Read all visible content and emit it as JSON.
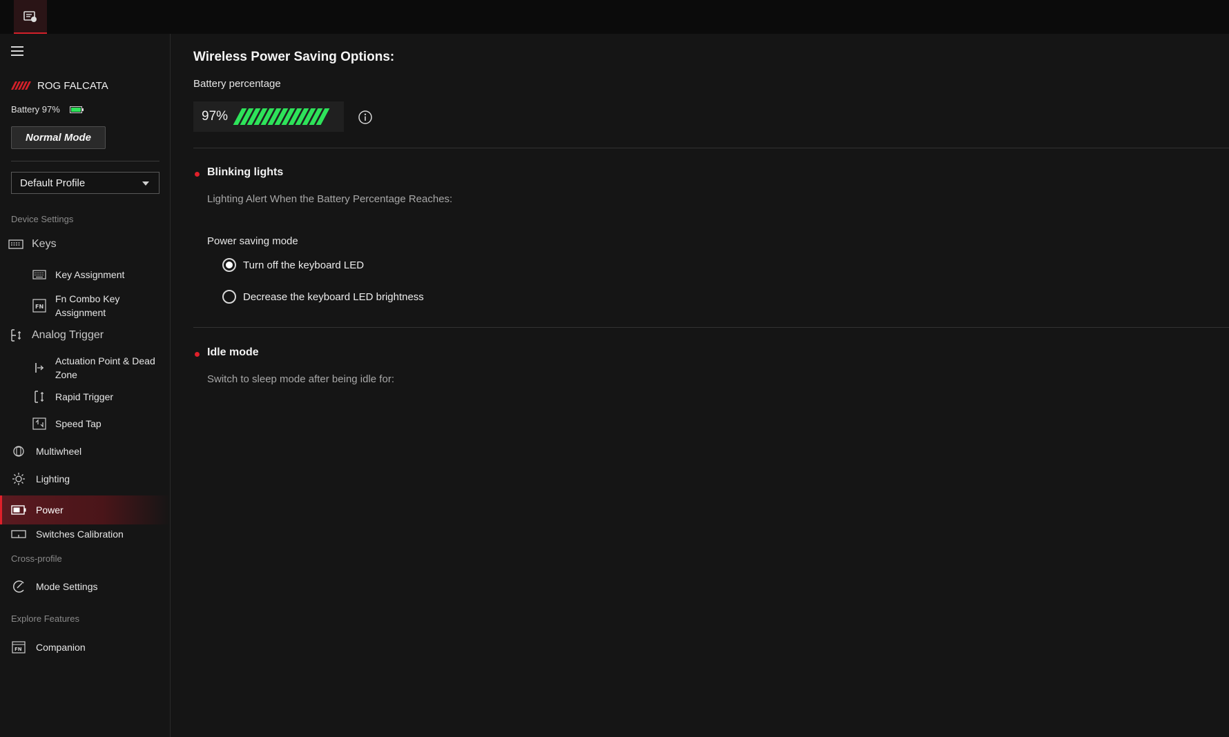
{
  "app": {
    "tab_icon": "armoury-app-icon"
  },
  "sidebar": {
    "device_name": "ROG FALCATA",
    "battery_label": "Battery 97%",
    "mode_button": "Normal Mode",
    "profile": "Default Profile",
    "section_device": "Device Settings",
    "section_cross": "Cross-profile",
    "section_explore": "Explore Features",
    "items": {
      "keys": "Keys",
      "key_assignment": "Key Assignment",
      "fn_combo": "Fn Combo Key Assignment",
      "analog_trigger": "Analog Trigger",
      "actuation": "Actuation Point & Dead Zone",
      "rapid_trigger": "Rapid Trigger",
      "speed_tap": "Speed Tap",
      "multiwheel": "Multiwheel",
      "lighting": "Lighting",
      "power": "Power",
      "switches_calibration": "Switches Calibration",
      "mode_settings": "Mode Settings",
      "companion": "Companion"
    }
  },
  "main": {
    "title": "Wireless Power Saving Options:",
    "battery_label": "Battery percentage",
    "battery_value": "97%",
    "battery_level_percent": 97,
    "blinking": {
      "title": "Blinking lights",
      "desc": "Lighting Alert When the Battery Percentage Reaches:",
      "power_saving_label": "Power saving mode",
      "options": [
        {
          "label": "Turn off the keyboard LED",
          "selected": true
        },
        {
          "label": "Decrease the keyboard LED brightness",
          "selected": false
        }
      ]
    },
    "idle": {
      "title": "Idle mode",
      "desc": "Switch to sleep mode after being idle for:"
    }
  },
  "colors": {
    "accent": "#e0202a",
    "battery_green": "#2ee35a",
    "background": "#151515"
  }
}
